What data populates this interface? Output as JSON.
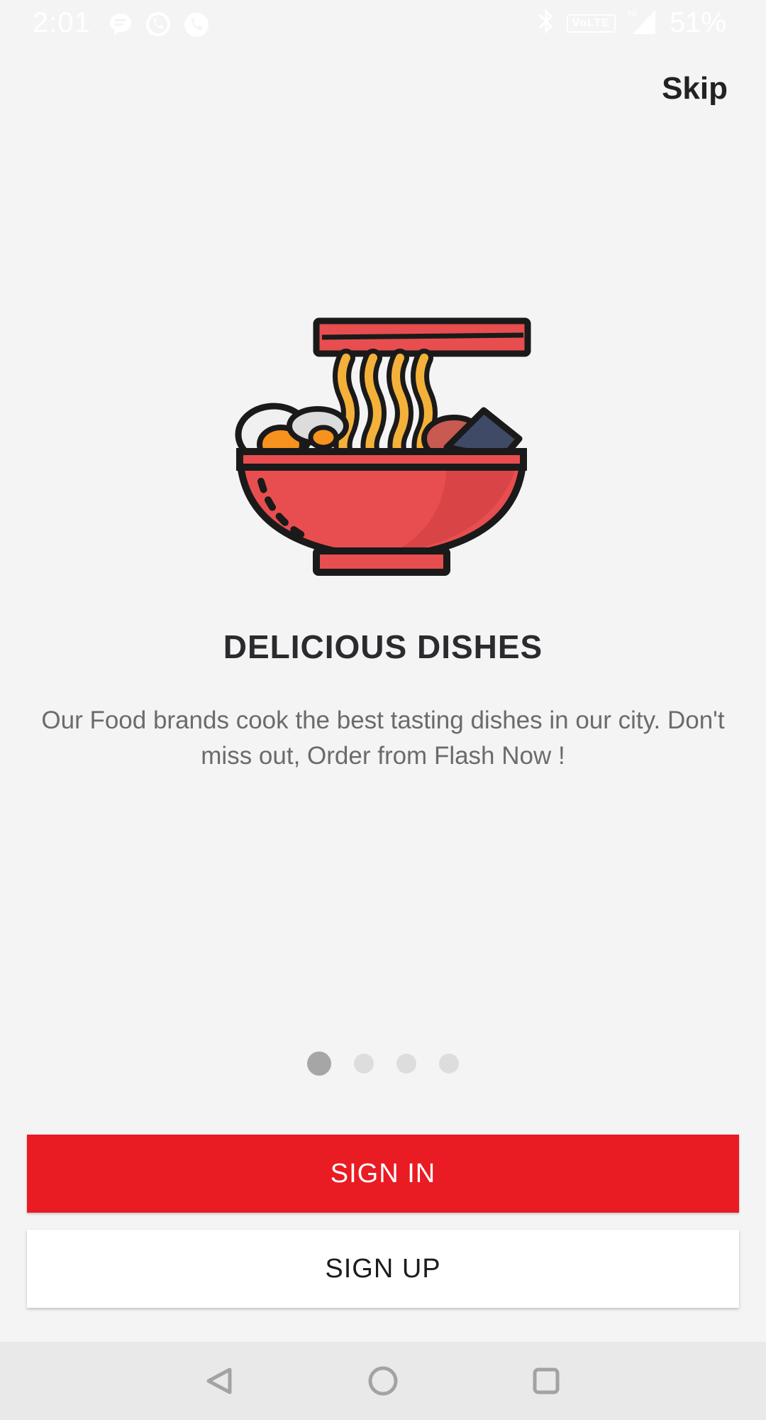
{
  "status_bar": {
    "time": "2:01",
    "network": "VoLTE",
    "battery": "51%"
  },
  "header": {
    "skip_label": "Skip"
  },
  "onboarding": {
    "title": "DELICIOUS DISHES",
    "description": "Our Food brands cook the best tasting dishes in our city. Don't miss out, Order from Flash Now !",
    "page_count": 4,
    "active_page": 1
  },
  "actions": {
    "signin_label": "SIGN IN",
    "signup_label": "SIGN UP"
  },
  "colors": {
    "primary": "#e91b23",
    "bowl": "#e84e4f",
    "noodle": "#f4b13a",
    "background": "#f4f4f4"
  },
  "icons": {
    "illustration": "noodle-bowl-icon",
    "nav_back": "back-triangle-icon",
    "nav_home": "home-circle-icon",
    "nav_recents": "recents-square-icon"
  }
}
